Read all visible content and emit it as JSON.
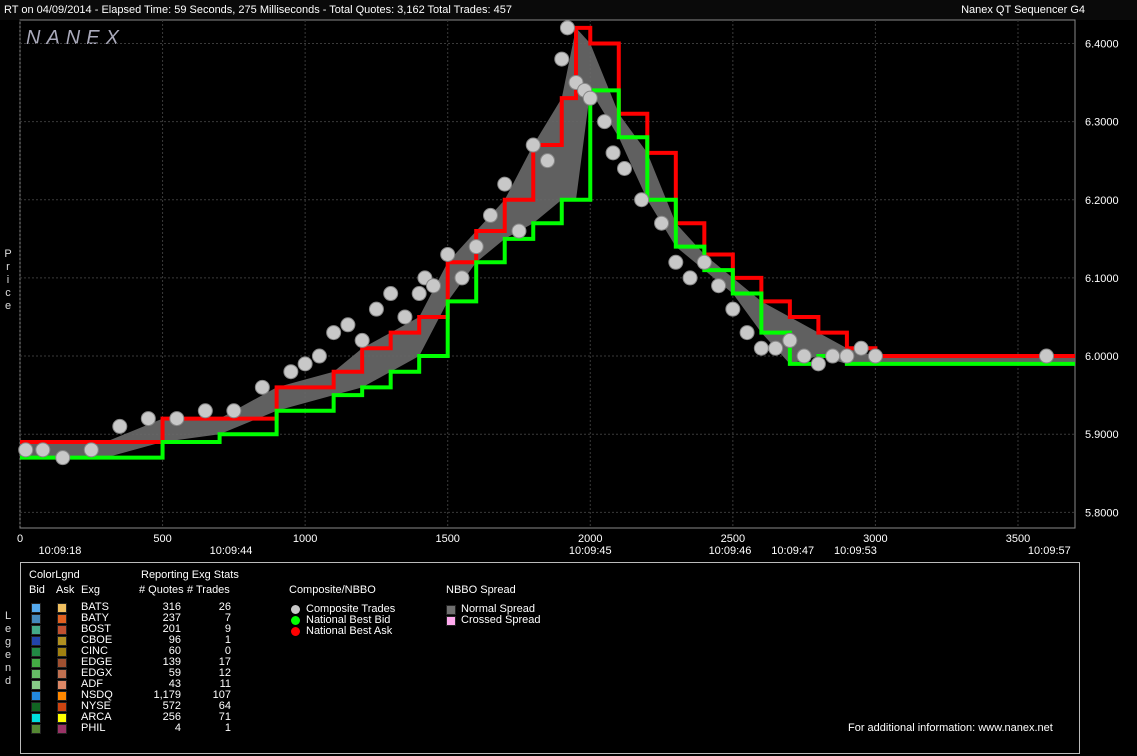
{
  "header": {
    "left_text": "RT on 04/09/2014  -  Elapsed Time: 59 Seconds, 275 Milliseconds  -  Total Quotes: 3,162  Total Trades: 457",
    "right_text": "Nanex QT Sequencer G4",
    "logo": "NANEX"
  },
  "side_labels": {
    "price": "Price",
    "legend": "Legend"
  },
  "chart_data": {
    "type": "line",
    "ylabel": "Price",
    "ylim": [
      5.78,
      6.43
    ],
    "xlim": [
      0,
      3700
    ],
    "y_ticks": [
      "6.4000",
      "6.3000",
      "6.2000",
      "6.1000",
      "6.0000",
      "5.9000",
      "5.8000"
    ],
    "x_ticks": [
      "0",
      "500",
      "1000",
      "1500",
      "2000",
      "2500",
      "3000",
      "3500"
    ],
    "time_labels": [
      {
        "x": 140,
        "label": "10:09:18"
      },
      {
        "x": 740,
        "label": "10:09:44"
      },
      {
        "x": 2000,
        "label": "10:09:45"
      },
      {
        "x": 2490,
        "label": "10:09:46"
      },
      {
        "x": 2710,
        "label": "10:09:47"
      },
      {
        "x": 2930,
        "label": "10:09:53"
      },
      {
        "x": 3610,
        "label": "10:09:57"
      }
    ],
    "series": [
      {
        "name": "National Best Bid",
        "color": "#00ff00",
        "x": [
          0,
          100,
          300,
          500,
          700,
          900,
          1100,
          1200,
          1300,
          1400,
          1500,
          1600,
          1700,
          1800,
          1900,
          1950,
          2000,
          2100,
          2200,
          2300,
          2400,
          2500,
          2600,
          2700,
          2800,
          2900,
          3000,
          3700
        ],
        "y": [
          5.87,
          5.87,
          5.87,
          5.89,
          5.9,
          5.93,
          5.95,
          5.96,
          5.98,
          6.0,
          6.07,
          6.12,
          6.15,
          6.17,
          6.2,
          6.2,
          6.34,
          6.28,
          6.2,
          6.14,
          6.11,
          6.08,
          6.03,
          5.99,
          6.0,
          5.99,
          5.99,
          5.99
        ]
      },
      {
        "name": "National Best Ask",
        "color": "#ff0000",
        "x": [
          0,
          100,
          300,
          500,
          700,
          900,
          1100,
          1200,
          1300,
          1400,
          1500,
          1600,
          1700,
          1800,
          1900,
          1950,
          2000,
          2100,
          2200,
          2300,
          2400,
          2500,
          2600,
          2700,
          2800,
          2900,
          3000,
          3700
        ],
        "y": [
          5.89,
          5.89,
          5.89,
          5.92,
          5.92,
          5.96,
          5.98,
          6.01,
          6.03,
          6.05,
          6.12,
          6.16,
          6.2,
          6.27,
          6.33,
          6.42,
          6.4,
          6.31,
          6.26,
          6.17,
          6.13,
          6.1,
          6.07,
          6.05,
          6.03,
          6.01,
          6.0,
          6.0
        ]
      },
      {
        "name": "Composite Trades",
        "color": "#c8c8c8",
        "x": [
          20,
          80,
          150,
          250,
          350,
          450,
          550,
          650,
          750,
          850,
          950,
          1000,
          1050,
          1100,
          1150,
          1200,
          1250,
          1300,
          1350,
          1400,
          1420,
          1450,
          1500,
          1550,
          1600,
          1650,
          1700,
          1750,
          1800,
          1850,
          1900,
          1920,
          1950,
          1980,
          2000,
          2050,
          2080,
          2120,
          2180,
          2250,
          2300,
          2350,
          2400,
          2450,
          2500,
          2550,
          2600,
          2650,
          2700,
          2750,
          2800,
          2850,
          2900,
          2950,
          3000,
          3600
        ],
        "y": [
          5.88,
          5.88,
          5.87,
          5.88,
          5.91,
          5.92,
          5.92,
          5.93,
          5.93,
          5.96,
          5.98,
          5.99,
          6.0,
          6.03,
          6.04,
          6.02,
          6.06,
          6.08,
          6.05,
          6.08,
          6.1,
          6.09,
          6.13,
          6.1,
          6.14,
          6.18,
          6.22,
          6.16,
          6.27,
          6.25,
          6.38,
          6.42,
          6.35,
          6.34,
          6.33,
          6.3,
          6.26,
          6.24,
          6.2,
          6.17,
          6.12,
          6.1,
          6.12,
          6.09,
          6.06,
          6.03,
          6.01,
          6.01,
          6.02,
          6.0,
          5.99,
          6.0,
          6.0,
          6.01,
          6.0,
          6.0
        ]
      }
    ],
    "legend": {
      "colorlgnd_title": "ColorLgnd",
      "stats_title": "Reporting Exg Stats",
      "col_bid": "Bid",
      "col_ask": "Ask",
      "col_exg": "Exg",
      "col_quotes": "# Quotes",
      "col_trades": "# Trades",
      "exchanges": [
        {
          "name": "BATS",
          "quotes": "316",
          "trades": "26",
          "bid": "#55aaee",
          "ask": "#f0c060"
        },
        {
          "name": "BATY",
          "quotes": "237",
          "trades": "7",
          "bid": "#4488bb",
          "ask": "#e06020"
        },
        {
          "name": "BOST",
          "quotes": "201",
          "trades": "9",
          "bid": "#44aa88",
          "ask": "#c05030"
        },
        {
          "name": "CBOE",
          "quotes": "96",
          "trades": "1",
          "bid": "#2244aa",
          "ask": "#b09020"
        },
        {
          "name": "CINC",
          "quotes": "60",
          "trades": "0",
          "bid": "#228844",
          "ask": "#a08010"
        },
        {
          "name": "EDGE",
          "quotes": "139",
          "trades": "17",
          "bid": "#44aa44",
          "ask": "#a05030"
        },
        {
          "name": "EDGX",
          "quotes": "59",
          "trades": "12",
          "bid": "#66bb66",
          "ask": "#c07050"
        },
        {
          "name": "ADF",
          "quotes": "43",
          "trades": "11",
          "bid": "#88cc88",
          "ask": "#dd8866"
        },
        {
          "name": "NSDQ",
          "quotes": "1,179",
          "trades": "107",
          "bid": "#2288dd",
          "ask": "#ff8800"
        },
        {
          "name": "NYSE",
          "quotes": "572",
          "trades": "64",
          "bid": "#116622",
          "ask": "#cc4411"
        },
        {
          "name": "ARCA",
          "quotes": "256",
          "trades": "71",
          "bid": "#00dddd",
          "ask": "#ffff00"
        },
        {
          "name": "PHIL",
          "quotes": "4",
          "trades": "1",
          "bid": "#558833",
          "ask": "#993366"
        }
      ],
      "composite_title": "Composite/NBBO",
      "composite_items": [
        {
          "label": "Composite Trades",
          "color": "#c8c8c8"
        },
        {
          "label": "National Best Bid",
          "color": "#00ff00"
        },
        {
          "label": "National Best Ask",
          "color": "#ff0000"
        }
      ],
      "spread_title": "NBBO Spread",
      "spread_items": [
        {
          "label": "Normal Spread",
          "color": "#707070"
        },
        {
          "label": "Crossed Spread",
          "color": "#ffaaee"
        }
      ]
    }
  },
  "footer": "For additional information: www.nanex.net"
}
